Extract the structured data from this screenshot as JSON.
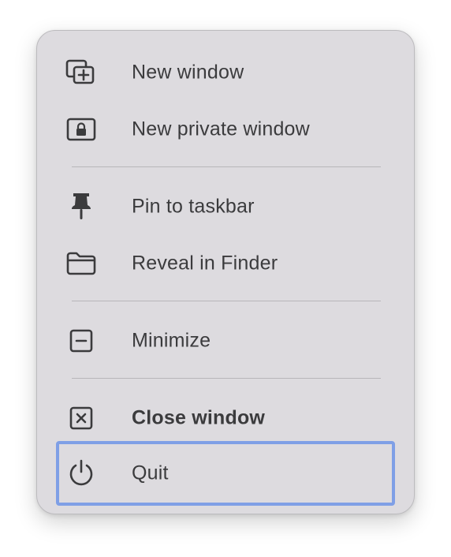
{
  "menu": {
    "items": [
      {
        "label": "New window",
        "icon": "new-window-icon"
      },
      {
        "label": "New private window",
        "icon": "private-window-lock-icon"
      },
      {
        "label": "Pin to taskbar",
        "icon": "pin-icon"
      },
      {
        "label": "Reveal in Finder",
        "icon": "folder-icon"
      },
      {
        "label": "Minimize",
        "icon": "minimize-icon"
      },
      {
        "label": "Close window",
        "icon": "close-window-icon",
        "emphasized": true
      },
      {
        "label": "Quit",
        "icon": "power-icon",
        "focused": true
      }
    ]
  },
  "colors": {
    "menu_background": "#dddbdf",
    "text": "#3b3b3d",
    "focus_ring": "#7f9fe6",
    "separator": "#b7b6b9"
  }
}
